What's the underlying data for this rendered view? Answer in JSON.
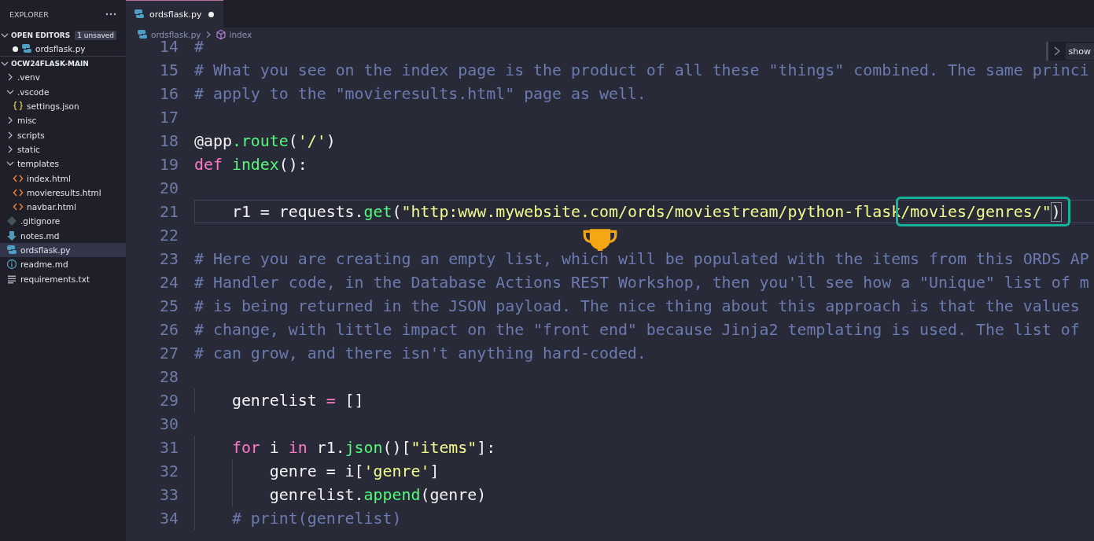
{
  "sidebar": {
    "title": "EXPLORER",
    "sections": [
      {
        "title": "OPEN EDITORS",
        "expanded": true,
        "badge": "1 unsaved",
        "items": [
          {
            "name": "ordsflask.py",
            "kind": "python",
            "dirty": true,
            "selected": false
          }
        ]
      },
      {
        "title": "OCW24FLASK-MAIN",
        "expanded": true,
        "items": [
          {
            "name": ".venv",
            "kind": "folder",
            "expanded": false,
            "selected": false
          },
          {
            "name": ".vscode",
            "kind": "folder",
            "expanded": true,
            "selected": false,
            "children": [
              {
                "name": "settings.json",
                "kind": "json",
                "selected": false
              }
            ]
          },
          {
            "name": "misc",
            "kind": "folder",
            "expanded": false,
            "selected": false
          },
          {
            "name": "scripts",
            "kind": "folder",
            "expanded": false,
            "selected": false
          },
          {
            "name": "static",
            "kind": "folder",
            "expanded": false,
            "selected": false
          },
          {
            "name": "templates",
            "kind": "folder",
            "expanded": true,
            "selected": false,
            "children": [
              {
                "name": "index.html",
                "kind": "html",
                "selected": false
              },
              {
                "name": "movieresults.html",
                "kind": "html",
                "selected": false
              },
              {
                "name": "navbar.html",
                "kind": "html",
                "selected": false
              }
            ]
          },
          {
            "name": ".gitignore",
            "kind": "git",
            "selected": false
          },
          {
            "name": "notes.md",
            "kind": "markdown",
            "selected": false
          },
          {
            "name": "ordsflask.py",
            "kind": "python",
            "selected": true
          },
          {
            "name": "readme.md",
            "kind": "info",
            "selected": false
          },
          {
            "name": "requirements.txt",
            "kind": "text",
            "selected": false
          }
        ]
      }
    ]
  },
  "tabs": [
    {
      "label": "ordsflask.py",
      "selected": true,
      "dirty": true
    }
  ],
  "breadcrumb": [
    {
      "label": "ordsflask.py",
      "kind": "python"
    },
    {
      "label": "index",
      "kind": "symbol"
    }
  ],
  "side_widget": {
    "text": "show"
  },
  "editor": {
    "lines": [
      {
        "number": "14",
        "current": false,
        "tokens": [
          {
            "kind": "comment",
            "text": "#"
          }
        ]
      },
      {
        "number": "15",
        "current": false,
        "tokens": [
          {
            "kind": "comment",
            "text": "# What you see on the index page is the product of all these \"things\" combined. The same princi"
          }
        ]
      },
      {
        "number": "16",
        "current": false,
        "tokens": [
          {
            "kind": "comment",
            "text": "# apply to the \"movieresults.html\" page as well."
          }
        ]
      },
      {
        "number": "17",
        "current": false
      },
      {
        "number": "18",
        "current": false,
        "tokens": [
          {
            "kind": "plain",
            "text": "@app"
          },
          {
            "kind": "function",
            "text": ".route"
          },
          {
            "kind": "plain",
            "text": "("
          },
          {
            "kind": "string",
            "text": "'/'"
          },
          {
            "kind": "plain",
            "text": ")"
          }
        ]
      },
      {
        "number": "19",
        "current": false,
        "tokens": [
          {
            "kind": "keyword",
            "text": "def "
          },
          {
            "kind": "function",
            "text": "index"
          },
          {
            "kind": "plain",
            "text": "():"
          }
        ]
      },
      {
        "number": "20",
        "current": false
      },
      {
        "number": "21",
        "current": true,
        "tokens": [
          {
            "kind": "plain",
            "text": "    r1 = requests."
          },
          {
            "kind": "function",
            "text": "get"
          },
          {
            "kind": "plain",
            "text": "("
          },
          {
            "kind": "string",
            "text": "\"http:www.mywebsite.com/ords/moviestream/python-flask"
          },
          {
            "kind": "string",
            "text": "/movies/genres/\"",
            "boxed": true
          },
          {
            "kind": "bracket_match",
            "text": ")",
            "boxed": true
          }
        ]
      },
      {
        "number": "22",
        "current": false
      },
      {
        "number": "23",
        "current": false,
        "tokens": [
          {
            "kind": "comment",
            "text": "# Here you are creating an empty list, which will be populated with the items from this ORDS AP"
          }
        ]
      },
      {
        "number": "24",
        "current": false,
        "tokens": [
          {
            "kind": "comment",
            "text": "# Handler code, in the Database Actions REST Workshop, then you'll see how a \"Unique\" list of m"
          }
        ]
      },
      {
        "number": "25",
        "current": false,
        "tokens": [
          {
            "kind": "comment",
            "text": "# is being returned in the JSON payload. The nice thing about this approach is that the values"
          }
        ]
      },
      {
        "number": "26",
        "current": false,
        "tokens": [
          {
            "kind": "comment",
            "text": "# change, with little impact on the \"front end\" because Jinja2 templating is used. The list of"
          }
        ]
      },
      {
        "number": "27",
        "current": false,
        "tokens": [
          {
            "kind": "comment",
            "text": "# can grow, and there isn't anything hard-coded."
          }
        ]
      },
      {
        "number": "28",
        "current": false
      },
      {
        "number": "29",
        "current": false,
        "tokens": [
          {
            "kind": "plain",
            "text": "    genrelist "
          },
          {
            "kind": "keyword",
            "text": "="
          },
          {
            "kind": "plain",
            "text": " []"
          }
        ]
      },
      {
        "number": "30",
        "current": false
      },
      {
        "number": "31",
        "current": false,
        "tokens": [
          {
            "kind": "keyword",
            "text": "    for"
          },
          {
            "kind": "plain",
            "text": " i "
          },
          {
            "kind": "keyword",
            "text": "in"
          },
          {
            "kind": "plain",
            "text": " r1."
          },
          {
            "kind": "function",
            "text": "json"
          },
          {
            "kind": "plain",
            "text": "()["
          },
          {
            "kind": "string",
            "text": "\"items\""
          },
          {
            "kind": "plain",
            "text": "]:"
          }
        ]
      },
      {
        "number": "32",
        "current": false,
        "tokens": [
          {
            "kind": "plain",
            "text": "        genre = i["
          },
          {
            "kind": "string",
            "text": "'genre'"
          },
          {
            "kind": "plain",
            "text": "]"
          }
        ]
      },
      {
        "number": "33",
        "current": false,
        "tokens": [
          {
            "kind": "plain",
            "text": "        genrelist."
          },
          {
            "kind": "function",
            "text": "append"
          },
          {
            "kind": "plain",
            "text": "(genre)"
          }
        ]
      },
      {
        "number": "34",
        "current": false,
        "tokens": [
          {
            "kind": "comment",
            "text": "    # print(genrelist)"
          }
        ]
      }
    ]
  }
}
